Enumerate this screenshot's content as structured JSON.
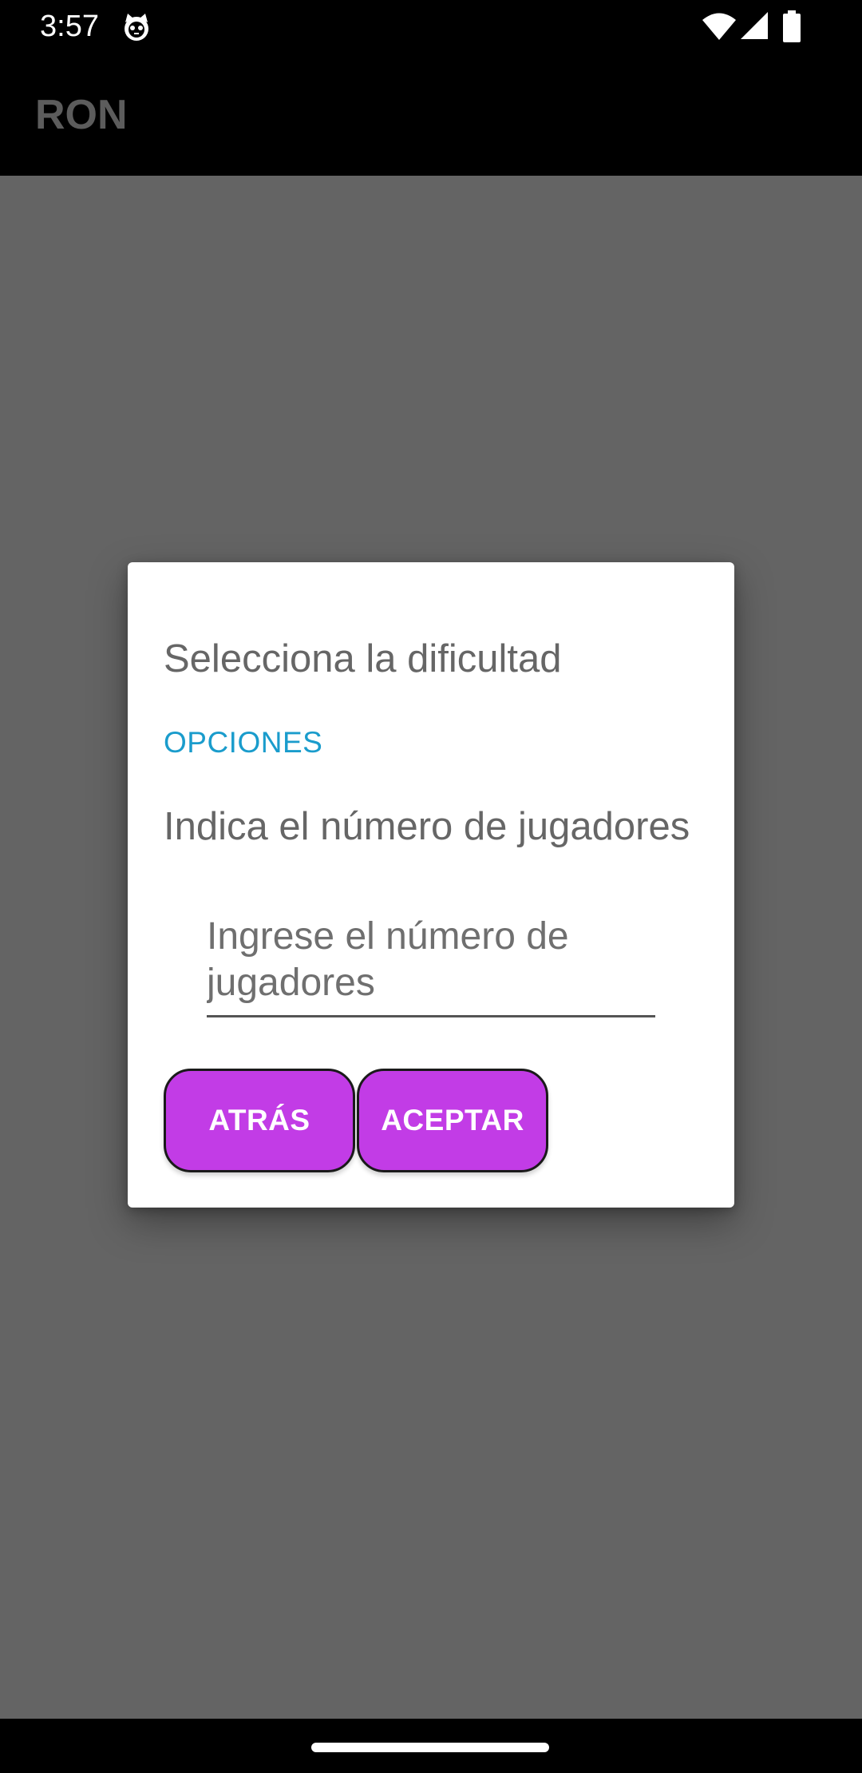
{
  "status_bar": {
    "time": "3:57",
    "icons": [
      "cat-notification-icon",
      "wifi-icon",
      "signal-icon",
      "battery-icon"
    ]
  },
  "app_bar": {
    "title": "RON"
  },
  "dialog": {
    "title": "Selecciona la dificultad",
    "section_label": "OPCIONES",
    "players_prompt": "Indica el número de jugadores",
    "players_input": {
      "value": "",
      "placeholder": "Ingrese el número de jugadores"
    },
    "buttons": {
      "back_label": "ATRÁS",
      "accept_label": "ACEPTAR"
    }
  },
  "colors": {
    "button_fill": "#c23ce6",
    "section_label": "#1a9ccc",
    "scrim": "#646464",
    "app_title": "#5c5c5c"
  }
}
